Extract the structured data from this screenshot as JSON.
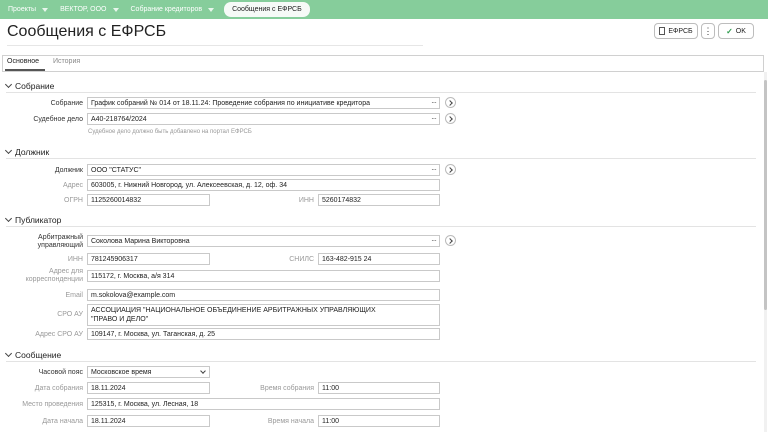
{
  "breadcrumbs": {
    "items": [
      "Проекты",
      "ВЕКТОР, ООО",
      "Собрание кредиторов"
    ],
    "active": "Сообщения с ЕФРСБ"
  },
  "header": {
    "title": "Сообщения с ЕФРСБ",
    "efrsb_button": "ЕФРСБ",
    "more_button": "⋮",
    "ok_button": "OK"
  },
  "tabs": {
    "main": "Основное",
    "history": "История"
  },
  "sections": {
    "meeting": {
      "title": "Собрание",
      "meeting_label": "Собрание",
      "meeting_value": "График собраний № 014 от 18.11.24: Проведение собрания по инициативе кредитора",
      "case_label": "Судебное дело",
      "case_value": "А40-218764/2024",
      "case_hint": "Судебное дело должно быть добавлено на портал ЕФРСБ"
    },
    "debtor": {
      "title": "Должник",
      "debtor_label": "Должник",
      "debtor_value": "ООО \"СТАТУС\"",
      "address_label": "Адрес",
      "address_value": "603005, г. Нижний Новгород, ул. Алексеевская, д. 12, оф. 34",
      "ogrn_label": "ОГРН",
      "ogrn_value": "1125260014832",
      "inn_label": "ИНН",
      "inn_value": "5260174832"
    },
    "publisher": {
      "title": "Публикатор",
      "manager_label_1": "Арбитражный",
      "manager_label_2": "управляющий",
      "manager_value": "Соколова Марина Викторовна",
      "inn_label": "ИНН",
      "inn_value": "781245906317",
      "snils_label": "СНИЛС",
      "snils_value": "163-482-915 24",
      "mail_label_1": "Адрес для",
      "mail_label_2": "корреспонденции",
      "mail_value": "115172, г. Москва, а/я 314",
      "email_label": "Email",
      "email_value": "m.sokolova@example.com",
      "sro_label": "СРО АУ",
      "sro_value_1": "АССОЦИАЦИЯ \"НАЦИОНАЛЬНОЕ ОБЪЕДИНЕНИЕ АРБИТРАЖНЫХ УПРАВЛЯЮЩИХ",
      "sro_value_2": "\"ПРАВО И ДЕЛО\"",
      "sro_address_label": "Адрес СРО АУ",
      "sro_address_value": "109147, г. Москва, ул. Таганская, д. 25"
    },
    "message": {
      "title": "Сообщение",
      "tz_label": "Часовой пояс",
      "tz_value": "Московское время",
      "date_label": "Дата собрания",
      "date_value": "18.11.2024",
      "time_label": "Время собрания",
      "time_value": "11:00",
      "place_label": "Место проведения",
      "place_value": "125315, г. Москва, ул. Лесная, 18",
      "start_date_label": "Дата начала",
      "start_date_value": "18.11.2024",
      "start_time_label": "Время начала",
      "start_time_value": "11:00"
    }
  },
  "colors": {
    "breadcrumb_bar": "#86cd9b",
    "ok_check": "#2e9c4e"
  }
}
